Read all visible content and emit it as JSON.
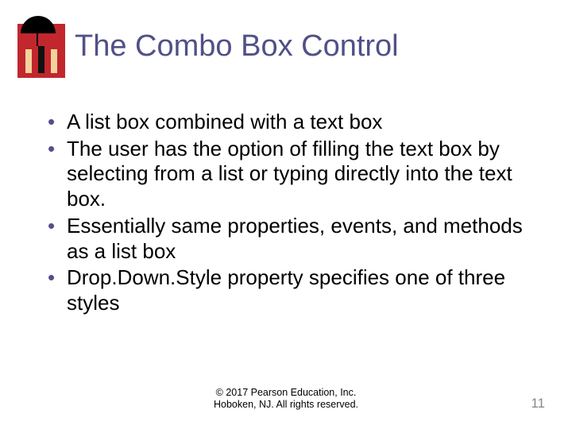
{
  "title": "The Combo Box Control",
  "bullets": [
    "A list box combined with a text box",
    "The user has the option of filling the text box by selecting from a list or typing directly into the text box.",
    "Essentially same properties, events, and methods as a list box",
    "Drop.Down.Style property specifies one of three styles"
  ],
  "footer": {
    "line1": "© 2017 Pearson Education, Inc.",
    "line2": "Hoboken, NJ. All rights reserved."
  },
  "page_number": "11"
}
